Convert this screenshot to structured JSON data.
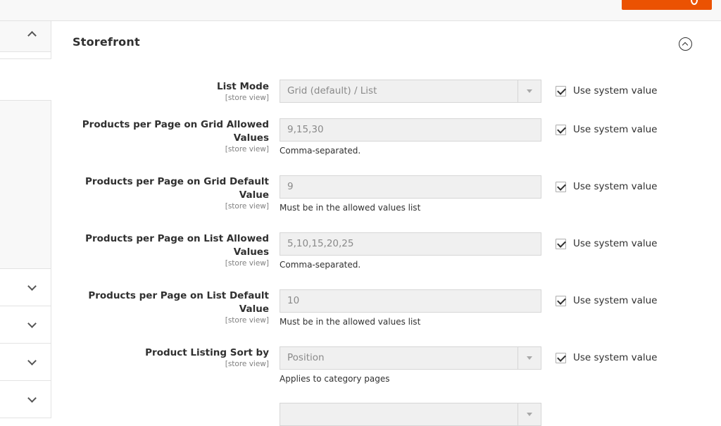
{
  "section": {
    "title": "Storefront"
  },
  "fields": [
    {
      "label": "List Mode",
      "scope": "[store view]",
      "type": "select",
      "value": "Grid (default) / List",
      "note": "",
      "use_system": "Use system value"
    },
    {
      "label": "Products per Page on Grid Allowed Values",
      "scope": "[store view]",
      "type": "text",
      "value": "9,15,30",
      "note": "Comma-separated.",
      "use_system": "Use system value"
    },
    {
      "label": "Products per Page on Grid Default Value",
      "scope": "[store view]",
      "type": "text",
      "value": "9",
      "note": "Must be in the allowed values list",
      "use_system": "Use system value"
    },
    {
      "label": "Products per Page on List Allowed Values",
      "scope": "[store view]",
      "type": "text",
      "value": "5,10,15,20,25",
      "note": "Comma-separated.",
      "use_system": "Use system value"
    },
    {
      "label": "Products per Page on List Default Value",
      "scope": "[store view]",
      "type": "text",
      "value": "10",
      "note": "Must be in the allowed values list",
      "use_system": "Use system value"
    },
    {
      "label": "Product Listing Sort by",
      "scope": "[store view]",
      "type": "select",
      "value": "Position",
      "note": "Applies to category pages",
      "use_system": "Use system value"
    }
  ],
  "colors": {
    "accent": "#eb5202",
    "disabled_bg": "#f0f0f0",
    "border": "#d6d6d6"
  },
  "icons": {
    "collapse": "chevron-up-circle-icon",
    "sidebar_expand": "chevron-down-icon",
    "sidebar_collapse": "chevron-up-icon"
  }
}
